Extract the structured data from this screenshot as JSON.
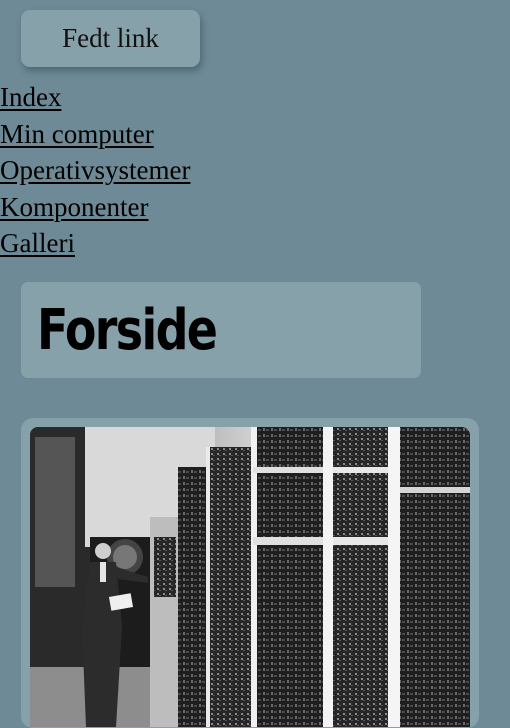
{
  "button": {
    "label": "Fedt link"
  },
  "nav": {
    "items": [
      {
        "label": "Index"
      },
      {
        "label": "Min computer"
      },
      {
        "label": "Operativsystemer"
      },
      {
        "label": "Komponenter"
      },
      {
        "label": "Galleri"
      }
    ]
  },
  "page": {
    "title": "Forside"
  },
  "colors": {
    "background": "#6d8a96",
    "panel": "#87a1aa",
    "text": "#000000"
  },
  "image": {
    "icon": "mainframe-computer-photo"
  }
}
